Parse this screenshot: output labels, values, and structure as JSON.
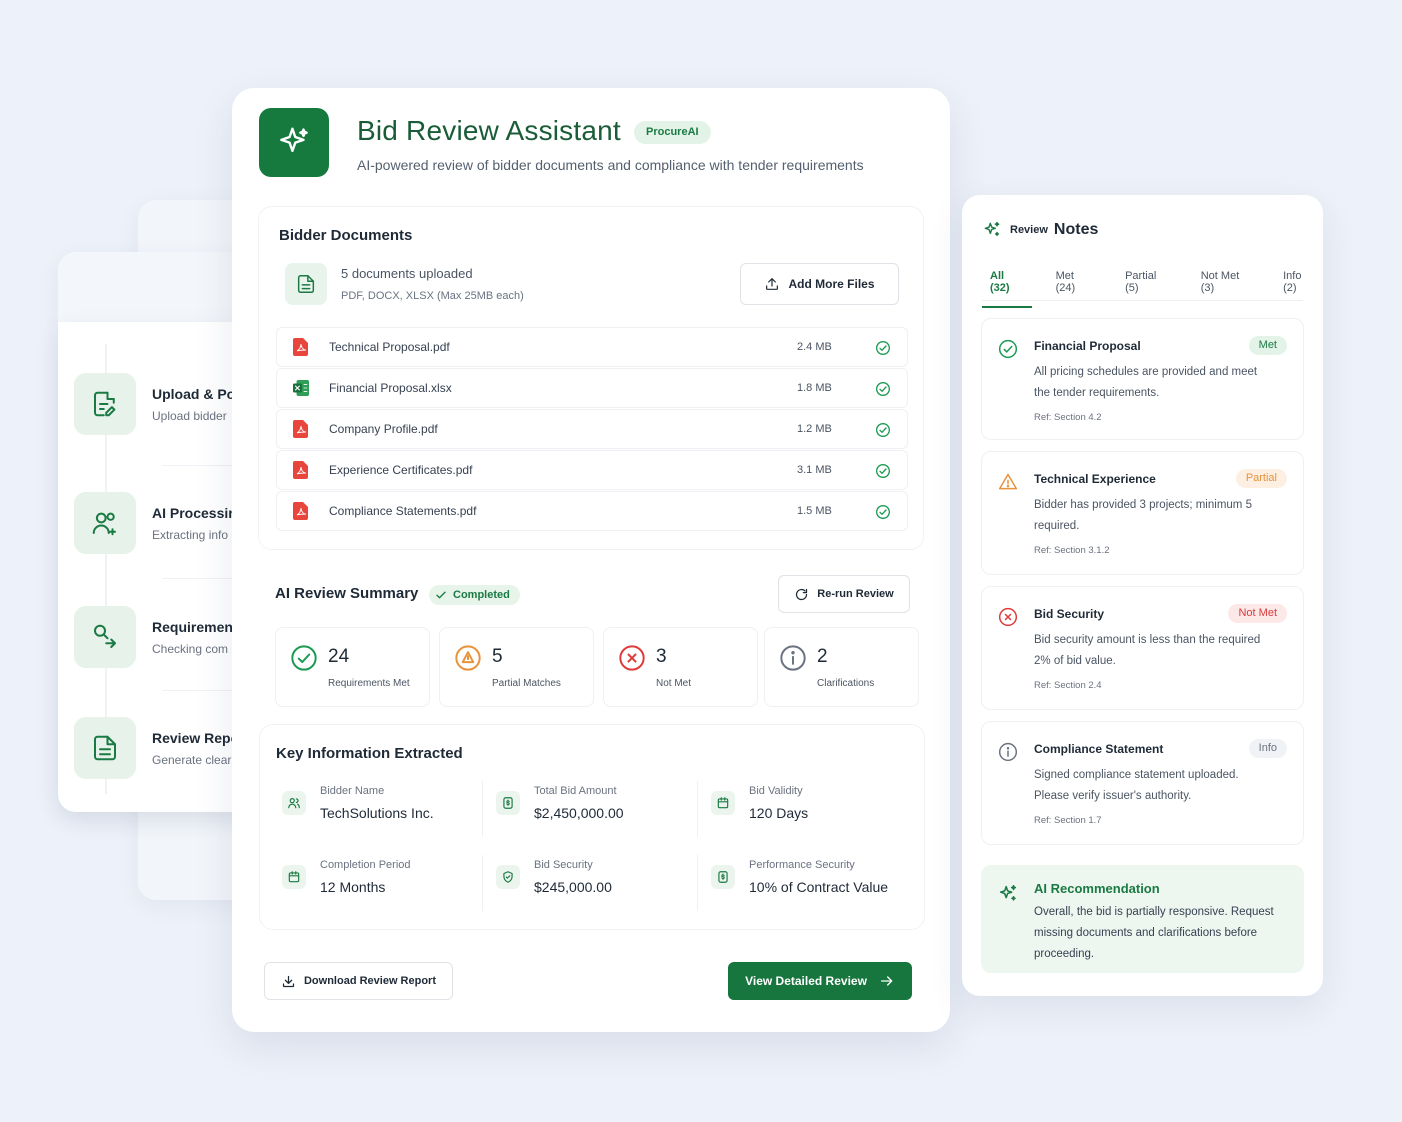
{
  "colors": {
    "brand": "#167a3e",
    "met": "#1b7a43",
    "partial": "#e8923b",
    "not_met": "#e03b3b",
    "info": "#6b7280"
  },
  "steps": [
    {
      "title": "Upload & Po",
      "sub": "Upload bidder",
      "icon": "document-edit-icon"
    },
    {
      "title": "AI Processir",
      "sub": "Extracting info",
      "icon": "users-add-icon"
    },
    {
      "title": "Requiremen",
      "sub": "Checking com",
      "icon": "search-route-icon"
    },
    {
      "title": "Review Repo",
      "sub": "Generate clear",
      "icon": "report-icon"
    }
  ],
  "header": {
    "title": "Bid Review Assistant",
    "badge": "ProcureAI",
    "subtitle": "AI-powered review of bidder documents and compliance with tender requirements"
  },
  "documents": {
    "title": "Bidder Documents",
    "count_text": "5 documents uploaded",
    "types_text": "PDF, DOCX, XLSX (Max 25MB each)",
    "add_button": "Add More Files",
    "files": [
      {
        "name": "Technical Proposal.pdf",
        "size": "2.4 MB",
        "type": "pdf"
      },
      {
        "name": "Financial Proposal.xlsx",
        "size": "1.8 MB",
        "type": "xlsx"
      },
      {
        "name": "Company Profile.pdf",
        "size": "1.2 MB",
        "type": "pdf"
      },
      {
        "name": "Experience Certificates.pdf",
        "size": "3.1 MB",
        "type": "pdf"
      },
      {
        "name": "Compliance Statements.pdf",
        "size": "1.5 MB",
        "type": "pdf"
      }
    ]
  },
  "summary": {
    "title": "AI Review Summary",
    "status": "Completed",
    "rerun_button": "Re-run Review",
    "stats": [
      {
        "value": "24",
        "label": "Requirements Met",
        "icon": "check-circle-icon"
      },
      {
        "value": "5",
        "label": "Partial Matches",
        "icon": "warning-circle-icon"
      },
      {
        "value": "3",
        "label": "Not Met",
        "icon": "x-circle-icon"
      },
      {
        "value": "2",
        "label": "Clarifications",
        "icon": "info-circle-icon"
      }
    ]
  },
  "key_info": {
    "title": "Key Information Extracted",
    "items": [
      {
        "label": "Bidder Name",
        "value": "TechSolutions Inc.",
        "icon": "users-icon"
      },
      {
        "label": "Total Bid Amount",
        "value": "$2,450,000.00",
        "icon": "money-icon"
      },
      {
        "label": "Bid Validity",
        "value": "120 Days",
        "icon": "calendar-icon"
      },
      {
        "label": "Completion Period",
        "value": "12 Months",
        "icon": "calendar-icon"
      },
      {
        "label": "Bid Security",
        "value": "$245,000.00",
        "icon": "shield-icon"
      },
      {
        "label": "Performance Security",
        "value": "10% of Contract Value",
        "icon": "money-icon"
      }
    ]
  },
  "actions": {
    "download": "Download Review Report",
    "view": "View Detailed Review"
  },
  "notes": {
    "title_prefix": "Review",
    "title": "Notes",
    "tabs": [
      "All (32)",
      "Met (24)",
      "Partial (5)",
      "Not Met (3)",
      "Info (2)"
    ],
    "items": [
      {
        "title": "Financial Proposal",
        "badge": "Met",
        "desc": "All pricing schedules are provided and meet the tender requirements.",
        "ref": "Ref: Section 4.2",
        "status": "met"
      },
      {
        "title": "Technical Experience",
        "badge": "Partial",
        "desc": "Bidder has provided 3 projects; minimum 5 required.",
        "ref": "Ref: Section 3.1.2",
        "status": "partial"
      },
      {
        "title": "Bid Security",
        "badge": "Not Met",
        "desc": "Bid security amount is less than the required 2% of bid value.",
        "ref": "Ref: Section 2.4",
        "status": "not_met"
      },
      {
        "title": "Compliance Statement",
        "badge": "Info",
        "desc": "Signed compliance statement uploaded. Please verify issuer's authority.",
        "ref": "Ref: Section 1.7",
        "status": "info"
      }
    ],
    "recommendation": {
      "title": "AI Recommendation",
      "desc": "Overall, the bid is partially responsive. Request missing documents and clarifications before proceeding."
    }
  }
}
